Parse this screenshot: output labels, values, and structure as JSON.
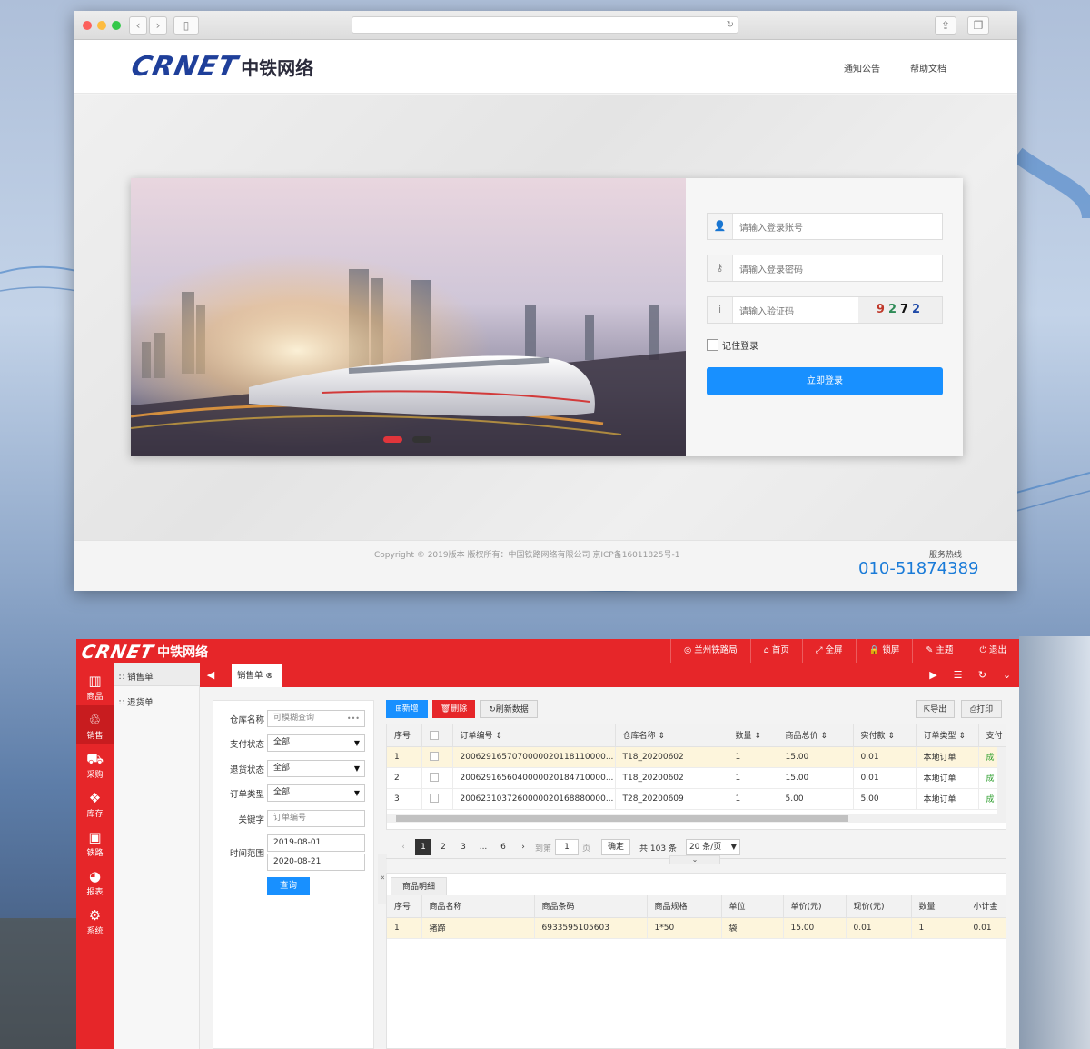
{
  "login": {
    "logo_en": "CRNET",
    "logo_cn": "中铁网络",
    "nav": [
      "通知公告",
      "帮助文档"
    ],
    "account_placeholder": "请输入登录账号",
    "password_placeholder": "请输入登录密码",
    "captcha_placeholder": "请输入验证码",
    "captcha_digits": [
      "9",
      "2",
      "7",
      "2"
    ],
    "captcha_colors": [
      "#c0392b",
      "#2e8b57",
      "#111111",
      "#1f4aa8"
    ],
    "remember": "记住登录",
    "login_button": "立即登录",
    "copyright": "Copyright © 2019版本  版权所有：中国铁路网络有限公司   京ICP备16011825号-1",
    "hotline_label": "服务热线",
    "hotline": "010-51874389",
    "accent": "#1890ff"
  },
  "admin": {
    "logo_en": "CRNET",
    "logo_cn": "中铁网络",
    "topnav": [
      "兰州铁路局",
      "首页",
      "全屏",
      "锁屏",
      "主题",
      "退出"
    ],
    "topnav_icons": [
      "◎",
      "⌂",
      "⤢",
      "🔒",
      "✎",
      "⏻"
    ],
    "sidebar": [
      {
        "icon": "▥",
        "label": "商品"
      },
      {
        "icon": "♲",
        "label": "销售"
      },
      {
        "icon": "⛟",
        "label": "采购"
      },
      {
        "icon": "❖",
        "label": "库存"
      },
      {
        "icon": "▣",
        "label": "铁路"
      },
      {
        "icon": "◕",
        "label": "报表"
      },
      {
        "icon": "⚙",
        "label": "系统"
      }
    ],
    "submenu": [
      "销售单",
      "退货单"
    ],
    "tab": "销售单",
    "filters": {
      "warehouse_label": "仓库名称",
      "warehouse_placeholder": "可模糊查询",
      "pay_label": "支付状态",
      "pay_value": "全部",
      "return_label": "退货状态",
      "return_value": "全部",
      "order_type_label": "订单类型",
      "order_type_value": "全部",
      "keyword_label": "关键字",
      "keyword_placeholder": "订单编号",
      "range_label": "时间范围",
      "date_from": "2019-08-01",
      "date_to": "2020-08-21",
      "query": "查询"
    },
    "toolbar": {
      "add": "新增",
      "delete": "删除",
      "refresh": "刷新数据",
      "export": "导出",
      "print": "打印"
    },
    "columns": [
      "序号",
      "",
      "订单编号",
      "仓库名称",
      "数量",
      "商品总价",
      "实付款",
      "订单类型",
      "支付"
    ],
    "rows": [
      [
        "1",
        "",
        "2006291657070000020118110000...",
        "T18_20200602",
        "1",
        "15.00",
        "0.01",
        "本地订单",
        "成"
      ],
      [
        "2",
        "",
        "2006291656040000020184710000...",
        "T18_20200602",
        "1",
        "15.00",
        "0.01",
        "本地订单",
        "成"
      ],
      [
        "3",
        "",
        "2006231037260000020168880000...",
        "T28_20200609",
        "1",
        "5.00",
        "5.00",
        "本地订单",
        "成"
      ]
    ],
    "pager": {
      "pages": [
        "1",
        "2",
        "3",
        "...",
        "6"
      ],
      "goto": "到第",
      "page_input": "1",
      "page_unit": "页",
      "confirm": "确定",
      "total": "共 103 条",
      "size": "20 条/页"
    },
    "detail_tab": "商品明细",
    "detail_columns": [
      "序号",
      "商品名称",
      "商品条码",
      "商品规格",
      "单位",
      "单价(元)",
      "现价(元)",
      "数量",
      "小计金"
    ],
    "detail_rows": [
      [
        "1",
        "猪蹄",
        "6933595105603",
        "1*50",
        "袋",
        "15.00",
        "0.01",
        "1",
        "0.01"
      ]
    ],
    "accent": "#e62629"
  }
}
